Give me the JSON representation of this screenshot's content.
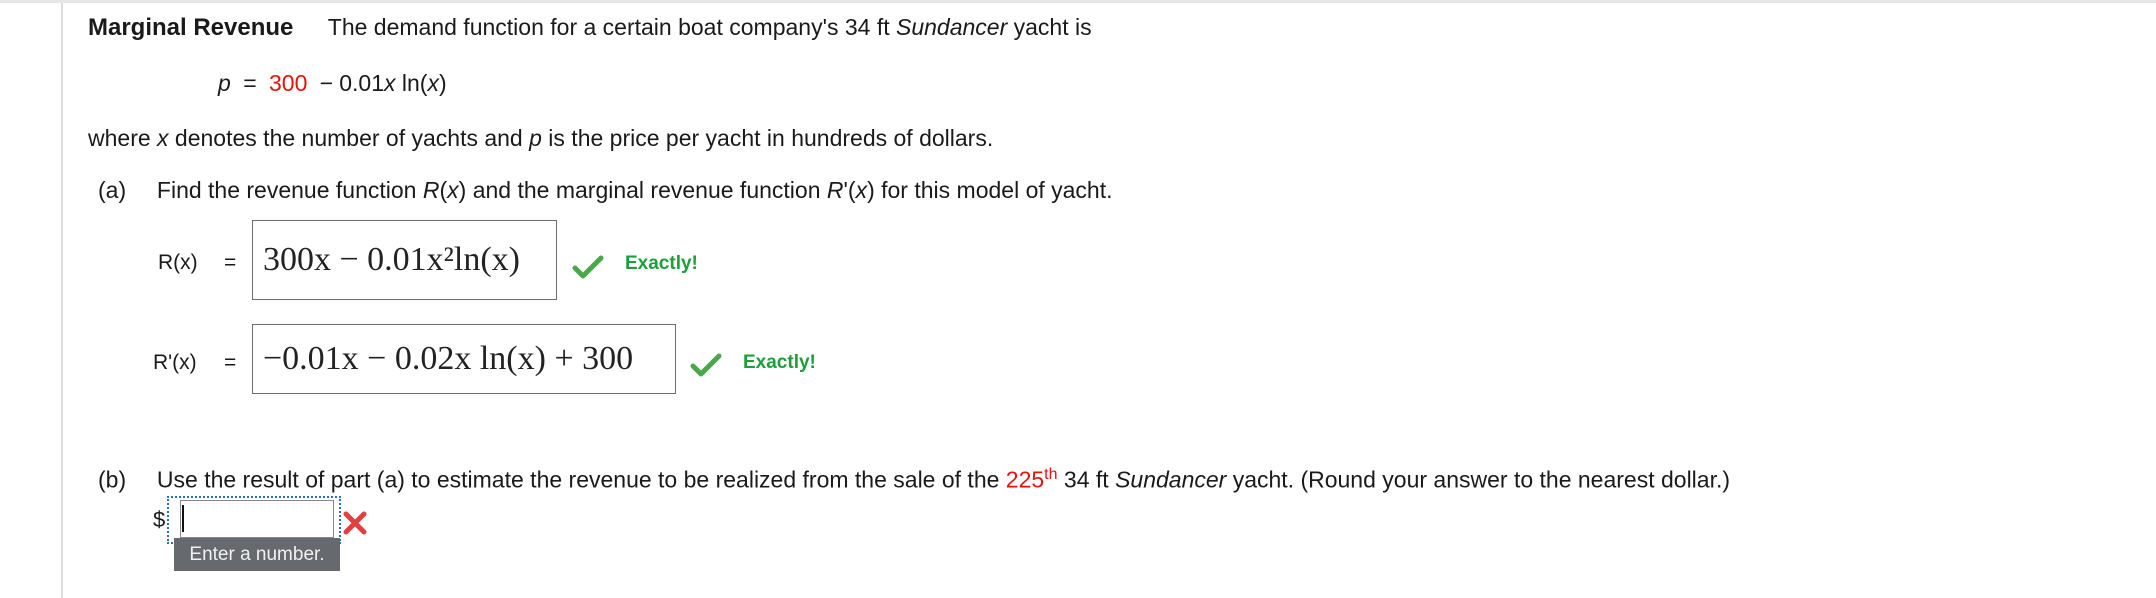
{
  "problem": {
    "title": "Marginal Revenue",
    "intro_before": "The demand function for a certain boat company's 34 ft ",
    "yacht_name": "Sundancer",
    "intro_after": " yacht is",
    "eq_p": "p",
    "eq_equals": "=",
    "eq_const": "300",
    "eq_minus": "−",
    "eq_rest_coef": "0.01",
    "eq_rest_x": "x",
    "eq_rest_ln": " ln(",
    "eq_rest_x2": "x",
    "eq_rest_close": ")",
    "where_1": "where ",
    "where_x": "x",
    "where_2": " denotes the number of yachts and ",
    "where_p": "p",
    "where_3": " is the price per yacht in hundreds of dollars."
  },
  "part_a": {
    "label": "(a)",
    "text_1": "Find the revenue function ",
    "text_R": "R",
    "text_2": "(",
    "text_x1": "x",
    "text_3": ") and the marginal revenue function ",
    "text_Rp": "R",
    "text_4": "'(",
    "text_x2": "x",
    "text_5": ") for this model of yacht.",
    "r_label": "R(x)",
    "r_equals": "=",
    "r_answer": "300x − 0.01x²ln(x)",
    "r_feedback": "Exactly!",
    "rp_label": "R'(x)",
    "rp_equals": "=",
    "rp_answer": "−0.01x − 0.02x ln(x) + 300",
    "rp_feedback": "Exactly!"
  },
  "part_b": {
    "label": "(b)",
    "text_1": "Use the result of part (a) to estimate the revenue to be realized from the sale of the ",
    "ordinal_num": "225",
    "ordinal_sup": "th",
    "text_2": " 34 ft ",
    "yacht_name": "Sundancer",
    "text_3": " yacht. (Round your answer to the nearest dollar.)",
    "currency": "$",
    "answer_value": "",
    "tooltip": "Enter a number."
  },
  "colors": {
    "accent_red": "#e8120c",
    "correct_green": "#1e9e3a",
    "focus_blue": "#2b6cd4",
    "wrong_red": "#e04040"
  }
}
